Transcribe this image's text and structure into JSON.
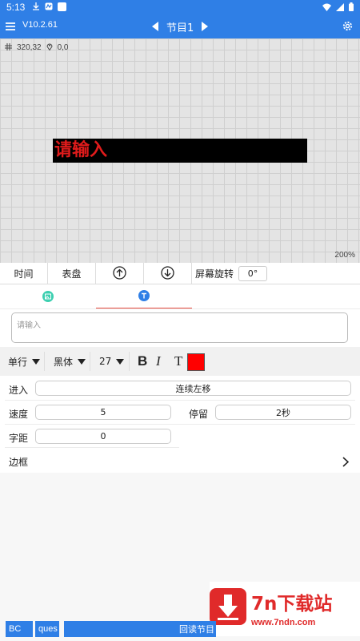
{
  "status_bar": {
    "time": "5:13",
    "icons": [
      "download-icon",
      "notification-icon",
      "square-icon",
      "wifi-icon",
      "signal-icon",
      "battery-icon"
    ]
  },
  "app_bar": {
    "version": "V10.2.61",
    "program_title": "节目1",
    "icons": [
      "menu-icon",
      "prev-icon",
      "next-icon",
      "settings-icon"
    ]
  },
  "canvas": {
    "size_readout": "320,32",
    "position_readout": "0,0",
    "led_text": "请输入",
    "zoom": "200%",
    "led_text_color": "#e01b1b",
    "background": "#e4e4e4"
  },
  "toolbar": {
    "time_label": "时间",
    "dial_label": "表盘",
    "screen_rotation_label": "屏幕旋转",
    "rotation_value": "0°"
  },
  "tabs": [
    {
      "name": "image-tab",
      "icon": "image-icon",
      "active": false
    },
    {
      "name": "text-tab",
      "icon": "text-icon",
      "active": true
    }
  ],
  "text_input": {
    "placeholder": "请输入"
  },
  "format": {
    "line_mode": "单行",
    "font": "黑体",
    "size": "27",
    "bold": "B",
    "italic": "I",
    "text_style": "T",
    "color": "#ff0000"
  },
  "fields": {
    "enter_label": "进入",
    "enter_value": "连续左移",
    "speed_label": "速度",
    "speed_value": "5",
    "stay_label": "停留",
    "stay_value": "2秒",
    "spacing_label": "字距",
    "spacing_value": "0",
    "border_label": "边框"
  },
  "watermark": {
    "brand": "7n下载站",
    "url": "www.7ndn.com"
  },
  "bottom_bar": {
    "left_text": "BC",
    "middle_text": "ques",
    "right_text": "回读节目"
  },
  "colors": {
    "primary": "#2f7fe6",
    "accent": "#e54a3d",
    "watermark": "#e02a2a"
  }
}
